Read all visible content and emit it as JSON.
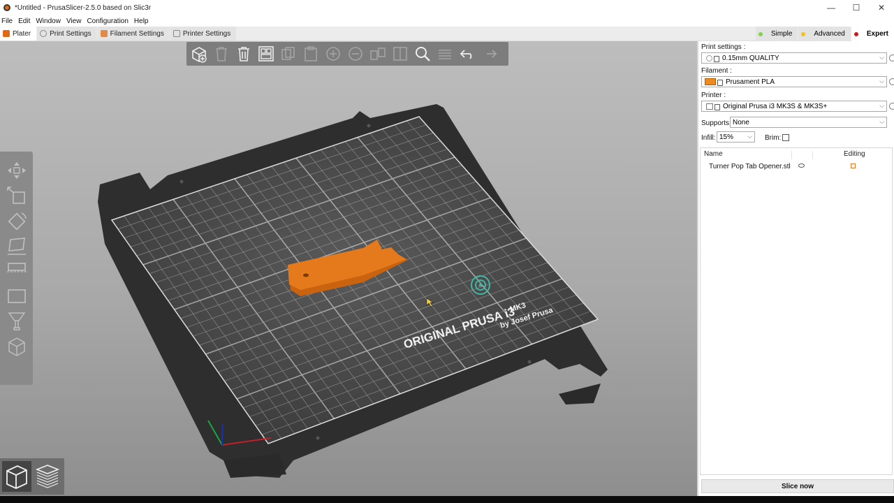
{
  "window": {
    "title": "*Untitled - PrusaSlicer-2.5.0 based on Slic3r",
    "minimize": "—",
    "maximize": "☐",
    "close": "✕"
  },
  "menu": [
    "File",
    "Edit",
    "Window",
    "View",
    "Configuration",
    "Help"
  ],
  "tabs": [
    {
      "label": "Plater",
      "active": true
    },
    {
      "label": "Print Settings"
    },
    {
      "label": "Filament Settings"
    },
    {
      "label": "Printer Settings"
    }
  ],
  "modes": [
    {
      "label": "Simple",
      "color": "#7fd04a"
    },
    {
      "label": "Advanced",
      "color": "#f2c21b"
    },
    {
      "label": "Expert",
      "color": "#d0151b",
      "active": true
    }
  ],
  "bed": {
    "brand": "ORIGINAL PRUSA i3",
    "model": "MK3",
    "byline": "by Josef Prusa"
  },
  "colors": {
    "accent": "#ed6b21",
    "model_fill": "#e57a1c",
    "bed_surface": "#3f3f3f",
    "grid": "#d8d8d8"
  },
  "sidebar": {
    "print_settings": {
      "label": "Print settings :",
      "value": "0.15mm QUALITY"
    },
    "filament": {
      "label": "Filament :",
      "value": "Prusament PLA"
    },
    "printer": {
      "label": "Printer :",
      "value": "Original Prusa i3 MK3S & MK3S+"
    },
    "supports": {
      "label": "Supports:",
      "value": "None"
    },
    "infill": {
      "label": "Infill:",
      "value": "15%"
    },
    "brim": {
      "label": "Brim:"
    },
    "object_list": {
      "col_name": "Name",
      "col_editing": "Editing",
      "items": [
        {
          "name": "Turner Pop Tab Opener.stl"
        }
      ]
    },
    "slice_button": "Slice now"
  }
}
